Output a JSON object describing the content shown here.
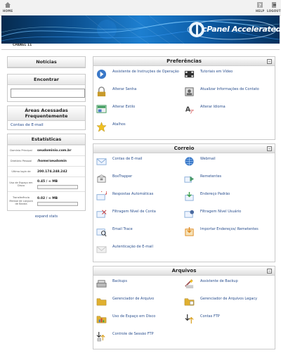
{
  "topbar": {
    "home": "HOME",
    "help": "HELP",
    "logout": "LOGOUT"
  },
  "brand": {
    "name": "cPanel Accelerated",
    "version": "2"
  },
  "breadcrumb": "CPANEL 11",
  "left": {
    "noticias": "Notícias",
    "encontrar": "Encontrar",
    "search_value": "",
    "areas_title": "Áreas Acessadas Frequentemente",
    "areas_link": "Contas de E-mail",
    "stats_title": "Estatísticas",
    "stats": [
      {
        "label": "Domínio Principal",
        "value": "seudominio.com.br"
      },
      {
        "label": "Diretório Pessoal",
        "value": "/home/seudomin"
      },
      {
        "label": "Último login de",
        "value": "200.174.248.242"
      },
      {
        "label": "Uso de Espaço em Disco",
        "value": "0.45 / ∞ MB",
        "fill": 0.0
      },
      {
        "label": "Transferência Mensal de Largura de Banda",
        "value": "0.02 / ∞ MB",
        "fill": 0.0
      }
    ],
    "expand": "expand stats"
  },
  "panels": [
    {
      "title": "Preferências",
      "items": [
        {
          "label": "Assistente de Instruções de Operação",
          "icon": "wizard-icon",
          "color": "#3a78c8"
        },
        {
          "label": "Tutoriais em Vídeo",
          "icon": "video-icon",
          "color": "#333333"
        },
        {
          "label": "Alterar Senha",
          "icon": "password-icon",
          "color": "#c89a2a"
        },
        {
          "label": "Atualizar Informações de Contato",
          "icon": "contact-icon",
          "color": "#666666"
        },
        {
          "label": "Alterar Estilo",
          "icon": "style-icon",
          "color": "#3a9a5a"
        },
        {
          "label": "Alterar Idioma",
          "icon": "language-icon",
          "color": "#444444"
        },
        {
          "label": "Atalhos",
          "icon": "star-icon",
          "color": "#f0c020"
        }
      ]
    },
    {
      "title": "Correio",
      "items": [
        {
          "label": "Contas de E-mail",
          "icon": "mail-icon",
          "color": "#8aaed8"
        },
        {
          "label": "Webmail",
          "icon": "webmail-icon",
          "color": "#3a78c8"
        },
        {
          "label": "BoxTrapper",
          "icon": "boxtrapper-icon",
          "color": "#8a8a8a"
        },
        {
          "label": "Remetentes",
          "icon": "forwarders-icon",
          "color": "#4a9a6a"
        },
        {
          "label": "Respostas Automáticas",
          "icon": "autoresponder-icon",
          "color": "#8aaed8"
        },
        {
          "label": "Endereço Padrão",
          "icon": "default-address-icon",
          "color": "#3aa04a"
        },
        {
          "label": "Filtragem Nível de Conta",
          "icon": "account-filter-icon",
          "color": "#8aaed8"
        },
        {
          "label": "Filtragem Nível Usuário",
          "icon": "user-filter-icon",
          "color": "#4a6aa0"
        },
        {
          "label": "Email Trace",
          "icon": "email-trace-icon",
          "color": "#8aaed8"
        },
        {
          "label": "Importar Endereços/ Remetentes",
          "icon": "import-icon",
          "color": "#e08a20"
        },
        {
          "label": "Autenticação de E-mail",
          "icon": "email-auth-icon",
          "color": "#c8c8c8"
        }
      ]
    },
    {
      "title": "Arquivos",
      "items": [
        {
          "label": "Backups",
          "icon": "backup-icon",
          "color": "#777777"
        },
        {
          "label": "Assistente de Backup",
          "icon": "backup-wizard-icon",
          "color": "#a05050"
        },
        {
          "label": "Gerenciador de Arquivo",
          "icon": "file-manager-icon",
          "color": "#e0b030"
        },
        {
          "label": "Gerenciador de Arquivos Legacy",
          "icon": "file-manager-legacy-icon",
          "color": "#e0b030"
        },
        {
          "label": "Uso de Espaço em Disco",
          "icon": "disk-usage-icon",
          "color": "#e0b030"
        },
        {
          "label": "Contas FTP",
          "icon": "ftp-icon",
          "color": "#d8a020"
        },
        {
          "label": "Controle de Sessão FTP",
          "icon": "ftp-session-icon",
          "color": "#d8a020"
        }
      ]
    }
  ]
}
